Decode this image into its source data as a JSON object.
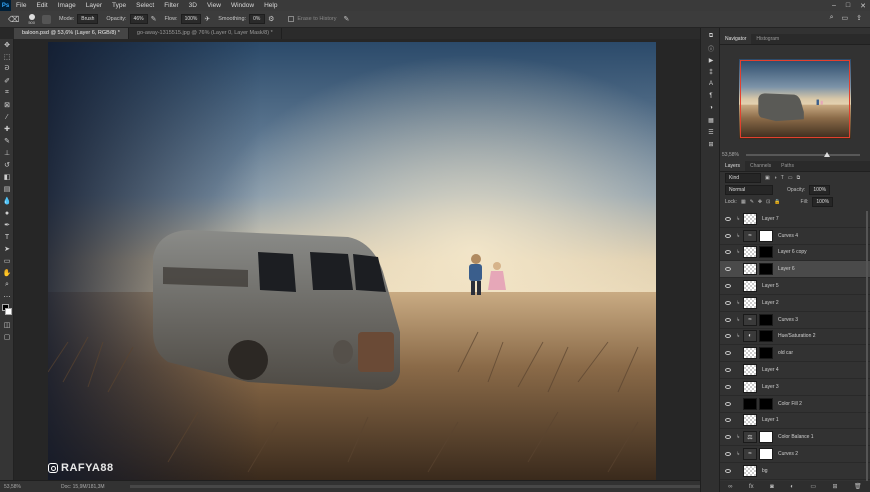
{
  "app": {
    "logo": "Ps",
    "menu": [
      "File",
      "Edit",
      "Image",
      "Layer",
      "Type",
      "Select",
      "Filter",
      "3D",
      "View",
      "Window",
      "Help"
    ],
    "window_controls": [
      "–",
      "□",
      "✕"
    ]
  },
  "options": {
    "brush_size": "500",
    "mode_label": "Mode:",
    "mode_value": "Brush",
    "opacity_label": "Opacity:",
    "opacity_value": "46%",
    "flow_label": "Flow:",
    "flow_value": "100%",
    "smoothing_label": "Smoothing:",
    "smoothing_value": "0%",
    "erase_to_history": "Erase to History"
  },
  "tabs": [
    {
      "label": "baloon.psd @ 53,6% (Layer 6, RGB/8) *",
      "active": true
    },
    {
      "label": "go-away-1315515.jpg @ 76% (Layer 0, Layer Mask/8) *",
      "active": false
    }
  ],
  "status": {
    "zoom": "53,58%",
    "doc": "Doc: 15,9M/181,3M"
  },
  "watermark": "RAFYA88",
  "navigator": {
    "tabs": [
      "Navigator",
      "Histogram"
    ],
    "zoom": "53,58%"
  },
  "layers": {
    "tabs": [
      "Layers",
      "Channels",
      "Paths"
    ],
    "filter_kind": "Kind",
    "blend_mode": "Normal",
    "opacity_label": "Opacity:",
    "opacity_value": "100%",
    "lock_label": "Lock:",
    "fill_label": "Fill:",
    "fill_value": "100%",
    "items": [
      {
        "name": "Layer 7",
        "thumb": "check",
        "mask": "",
        "clip": true,
        "selected": false,
        "icon": ""
      },
      {
        "name": "Curves 4",
        "thumb": "adj",
        "mask": "white",
        "clip": true,
        "selected": false,
        "icon": "≈"
      },
      {
        "name": "Layer 6 copy",
        "thumb": "check",
        "mask": "black",
        "clip": true,
        "selected": false,
        "icon": ""
      },
      {
        "name": "Layer 6",
        "thumb": "check",
        "mask": "black",
        "clip": false,
        "selected": true,
        "icon": ""
      },
      {
        "name": "Layer 5",
        "thumb": "check",
        "mask": "",
        "clip": false,
        "selected": false,
        "icon": ""
      },
      {
        "name": "Layer 2",
        "thumb": "check",
        "mask": "",
        "clip": true,
        "selected": false,
        "icon": ""
      },
      {
        "name": "Curves 3",
        "thumb": "adj",
        "mask": "black",
        "clip": true,
        "selected": false,
        "icon": "≈"
      },
      {
        "name": "Hue/Saturation 2",
        "thumb": "adj",
        "mask": "black",
        "clip": true,
        "selected": false,
        "icon": "◐"
      },
      {
        "name": "old car",
        "thumb": "check",
        "mask": "black",
        "clip": false,
        "selected": false,
        "icon": ""
      },
      {
        "name": "Layer 4",
        "thumb": "check",
        "mask": "",
        "clip": false,
        "selected": false,
        "icon": ""
      },
      {
        "name": "Layer 3",
        "thumb": "check",
        "mask": "",
        "clip": false,
        "selected": false,
        "icon": ""
      },
      {
        "name": "Color Fill 2",
        "thumb": "black",
        "mask": "black",
        "clip": false,
        "selected": false,
        "icon": ""
      },
      {
        "name": "Layer 1",
        "thumb": "check",
        "mask": "",
        "clip": false,
        "selected": false,
        "icon": ""
      },
      {
        "name": "Color Balance 1",
        "thumb": "adj",
        "mask": "white",
        "clip": true,
        "selected": false,
        "icon": "⚖"
      },
      {
        "name": "Curves 2",
        "thumb": "adj",
        "mask": "white",
        "clip": true,
        "selected": false,
        "icon": "≈"
      },
      {
        "name": "bg",
        "thumb": "check",
        "mask": "",
        "clip": false,
        "selected": false,
        "icon": ""
      }
    ]
  },
  "colors": {
    "accent_red": "#e3402e",
    "ui_dark": "#323232"
  }
}
